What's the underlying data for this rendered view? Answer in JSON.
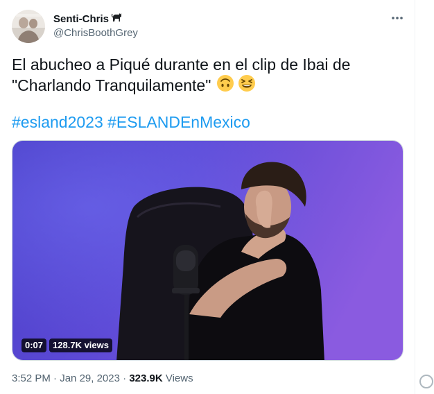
{
  "author": {
    "display_name": "Senti-Chris",
    "name_emoji": "cat-emoji",
    "handle": "@ChrisBoothGrey",
    "avatar": "profile-photo"
  },
  "more_icon": "ellipsis-icon",
  "tweet": {
    "line1": "El abucheo a Piqué durante en el clip de Ibai de",
    "line2": "\"Charlando Tranquilamente\"",
    "emojis": [
      "upside-down-face-emoji",
      "grinning-squinting-face-emoji"
    ],
    "hashtags": [
      "#esland2023",
      "#ESLANDEnMexico"
    ]
  },
  "video": {
    "duration": "0:07",
    "views": "128.7K views"
  },
  "meta": {
    "time": "3:52 PM",
    "separator": "·",
    "date": "Jan 29, 2023",
    "view_count": "323.9K",
    "views_label": "Views"
  },
  "colors": {
    "link": "#1d9bf0",
    "secondary_text": "#536471",
    "primary_text": "#0f1419"
  }
}
